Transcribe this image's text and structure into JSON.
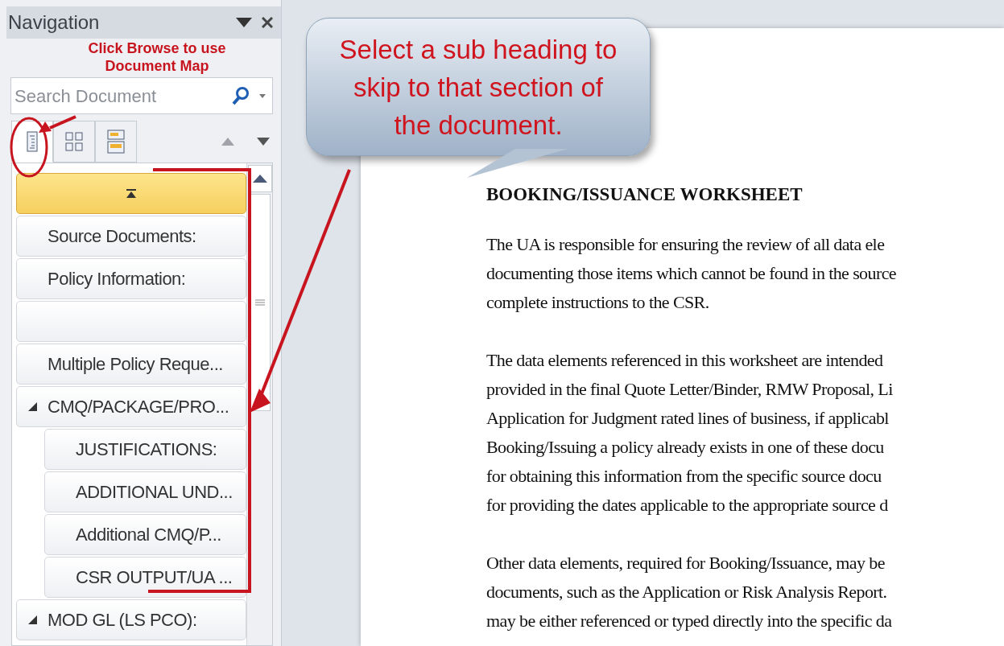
{
  "navigation": {
    "title": "Navigation",
    "search": {
      "placeholder": "Search Document"
    },
    "view_tabs": [
      {
        "kind": "headings",
        "selected": true
      },
      {
        "kind": "pages",
        "selected": false
      },
      {
        "kind": "results",
        "selected": false
      }
    ],
    "headings": [
      {
        "kind": "top",
        "selected": true
      },
      {
        "kind": "heading",
        "label": "Source Documents:",
        "selected": false
      },
      {
        "kind": "heading",
        "label": "Policy Information:",
        "selected": false
      },
      {
        "kind": "heading",
        "selected": false
      },
      {
        "kind": "heading",
        "label": "Multiple Policy Reque...",
        "selected": false
      },
      {
        "kind": "heading",
        "label": "CMQ/PACKAGE/PRO...",
        "selected": false,
        "expanded": true,
        "children": [
          {
            "kind": "heading",
            "label": "JUSTIFICATIONS:",
            "selected": false
          },
          {
            "kind": "heading",
            "label": "ADDITIONAL UND...",
            "selected": false
          },
          {
            "kind": "heading",
            "label": "Additional CMQ/P...",
            "selected": false
          },
          {
            "kind": "heading",
            "label": "CSR OUTPUT/UA ...",
            "selected": false
          }
        ]
      },
      {
        "kind": "heading",
        "label": "MOD GL (LS PCO):",
        "selected": false,
        "expanded": true
      }
    ]
  },
  "document": {
    "title": "BOOKING/ISSUANCE WORKSHEET",
    "paragraphs": [
      [
        "The UA is responsible for ensuring the review of all data ele",
        "documenting those items which cannot be found in the source",
        "complete instructions to the CSR."
      ],
      [
        "The data elements referenced in this worksheet are intended",
        "provided in the final Quote Letter/Binder, RMW Proposal, Li",
        "Application for Judgment rated lines of business, if applicabl",
        "Booking/Issuing a policy already exists in one of these docu",
        "for obtaining this information from the specific source docu",
        "for providing the dates applicable to the appropriate source d"
      ],
      [
        "Other data elements, required for Booking/Issuance, may be",
        "documents, such as the Application or Risk Analysis Report.",
        "may be either referenced or typed directly into the specific da"
      ]
    ]
  },
  "annotations": {
    "browse_note": [
      "Click Browse to use",
      "Document Map"
    ],
    "callout": [
      "Select a sub heading to",
      "skip to that section of",
      "the document."
    ]
  }
}
